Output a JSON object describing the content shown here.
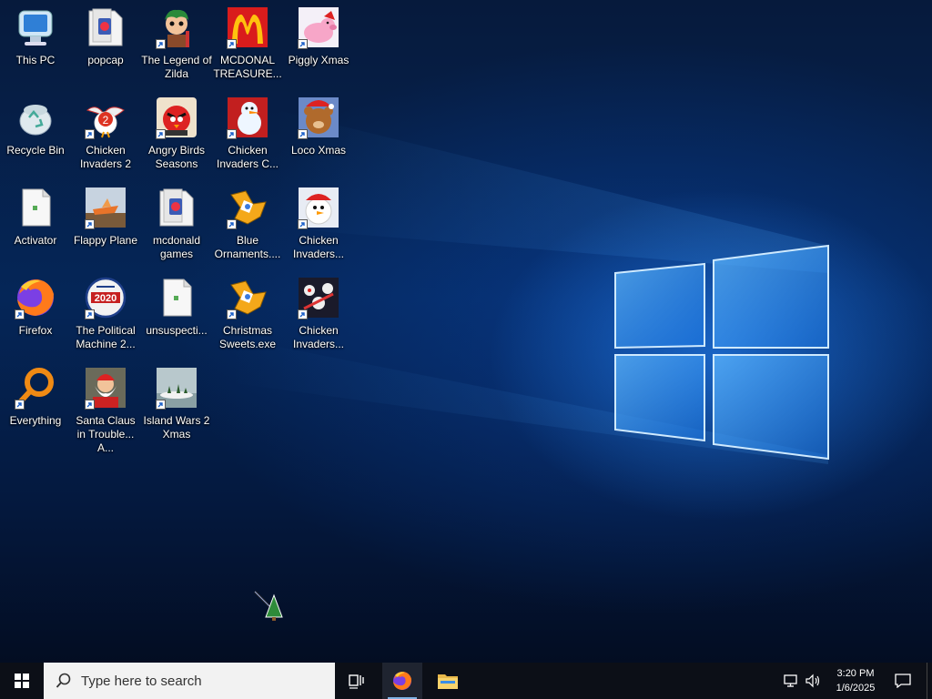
{
  "desktop": {
    "icons": [
      {
        "label": "This PC",
        "icon": "computer-icon",
        "shortcut": false
      },
      {
        "label": "popcap",
        "icon": "folder-icon",
        "shortcut": false
      },
      {
        "label": "The Legend of Zilda",
        "icon": "game-character-icon",
        "shortcut": true
      },
      {
        "label": "MCDONAL TREASURE...",
        "icon": "mcdonalds-logo-icon",
        "shortcut": true
      },
      {
        "label": "Piggly Xmas",
        "icon": "pig-icon",
        "shortcut": true
      },
      {
        "label": "Recycle Bin",
        "icon": "recycle-bin-icon",
        "shortcut": false
      },
      {
        "label": "Chicken Invaders 2",
        "icon": "chicken-icon",
        "shortcut": true
      },
      {
        "label": "Angry Birds Seasons",
        "icon": "angry-bird-icon",
        "shortcut": true
      },
      {
        "label": "Chicken Invaders C...",
        "icon": "snowman-icon",
        "shortcut": true
      },
      {
        "label": "Loco Xmas",
        "icon": "teddy-bear-icon",
        "shortcut": true
      },
      {
        "label": "Activator",
        "icon": "document-icon",
        "shortcut": false
      },
      {
        "label": "Flappy Plane",
        "icon": "plane-icon",
        "shortcut": true
      },
      {
        "label": "mcdonald games",
        "icon": "folder-icon",
        "shortcut": false
      },
      {
        "label": "Blue Ornaments....",
        "icon": "puzzle-icon",
        "shortcut": true
      },
      {
        "label": "Chicken Invaders...",
        "icon": "xmas-chicken-icon",
        "shortcut": true
      },
      {
        "label": "Firefox",
        "icon": "firefox-icon",
        "shortcut": true
      },
      {
        "label": "The Political Machine 2...",
        "icon": "political-2020-icon",
        "shortcut": true
      },
      {
        "label": "unsuspecti...",
        "icon": "document-icon",
        "shortcut": false
      },
      {
        "label": "Christmas Sweets.exe",
        "icon": "puzzle-icon",
        "shortcut": true
      },
      {
        "label": "Chicken Invaders...",
        "icon": "space-chicken-icon",
        "shortcut": true
      },
      {
        "label": "Everything",
        "icon": "magnifier-icon",
        "shortcut": true
      },
      {
        "label": "Santa Claus in Trouble... A...",
        "icon": "santa-icon",
        "shortcut": true
      },
      {
        "label": "Island Wars 2 Xmas",
        "icon": "island-icon",
        "shortcut": true
      }
    ]
  },
  "taskbar": {
    "search_placeholder": "Type here to search",
    "time": "3:20 PM",
    "date": "1/6/2025"
  },
  "colors": {
    "taskbar": "#0c0f17",
    "accent": "#7fb2e5"
  }
}
